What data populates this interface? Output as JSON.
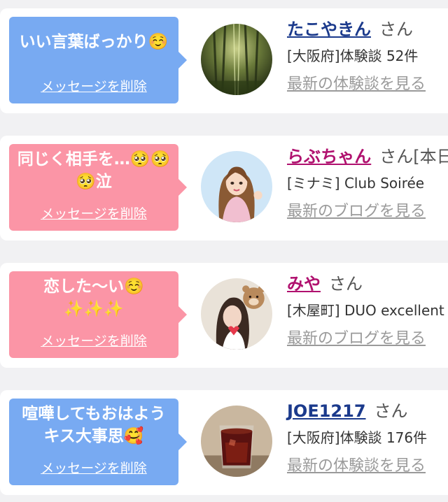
{
  "messages": [
    {
      "message": "いい言葉ばっかり☺️",
      "delete_label": "メッセージを削除",
      "bubble_color": "#78aaf2",
      "user_name": "たこやきん",
      "honorific": "さん",
      "meta": "[大阪府]体験談 52件",
      "link": "最新の体験談を見る",
      "avatar_icon": "bamboo-forest-photo"
    },
    {
      "message": "同じく相手を…🥺🥺🥺泣",
      "delete_label": "メッセージを削除",
      "bubble_color": "#fb95a6",
      "user_name": "らぶちゃん",
      "honorific": "さん[本日",
      "meta": "[ミナミ] Club Soirée",
      "link": "最新のブログを見る",
      "avatar_icon": "illustrated-woman-avatar"
    },
    {
      "message": "恋した〜い☺️✨✨✨",
      "delete_label": "メッセージを削除",
      "bubble_color": "#fb95a6",
      "user_name": "みや",
      "honorific": "さん",
      "meta": "[木屋町] DUO excellent",
      "link": "最新のブログを見る",
      "avatar_icon": "woman-with-bear-sticker-photo"
    },
    {
      "message": "喧嘩してもおはようキス大事思🥰",
      "delete_label": "メッセージを削除",
      "bubble_color": "#78aaf2",
      "user_name": "JOE1217",
      "honorific": "さん",
      "meta": "[大阪府]体験談 176件",
      "link": "最新の体験談を見る",
      "avatar_icon": "iced-drink-glass-photo"
    }
  ]
}
